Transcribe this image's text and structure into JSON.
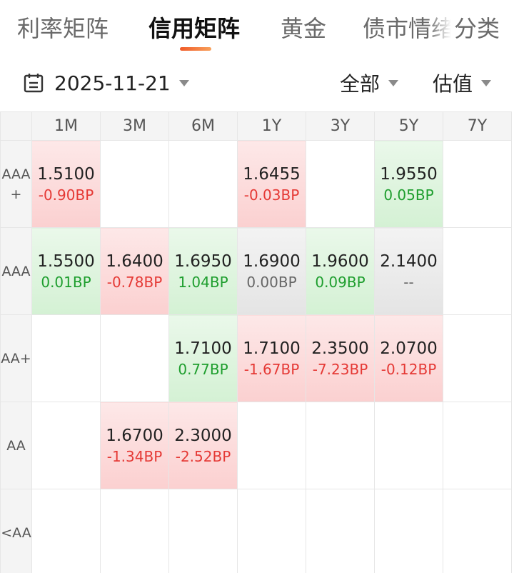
{
  "tabs": [
    {
      "label": "利率矩阵",
      "active": false
    },
    {
      "label": "信用矩阵",
      "active": true
    },
    {
      "label": "黄金",
      "active": false
    },
    {
      "label": "债市情绪",
      "active": false
    },
    {
      "label": "分类",
      "active": false
    }
  ],
  "filters": {
    "date": "2025-11-21",
    "scope": "全部",
    "metric": "估值"
  },
  "matrix": {
    "columns": [
      "1M",
      "3M",
      "6M",
      "1Y",
      "3Y",
      "5Y",
      "7Y"
    ],
    "rows": [
      {
        "rating": "AAA+",
        "cells": [
          {
            "value": "1.5100",
            "change": "-0.90BP",
            "trend": "up"
          },
          {
            "value": "",
            "change": "",
            "trend": "none"
          },
          {
            "value": "",
            "change": "",
            "trend": "none"
          },
          {
            "value": "1.6455",
            "change": "-0.03BP",
            "trend": "up"
          },
          {
            "value": "",
            "change": "",
            "trend": "none"
          },
          {
            "value": "1.9550",
            "change": "0.05BP",
            "trend": "down"
          },
          {
            "value": "",
            "change": "",
            "trend": "none"
          }
        ]
      },
      {
        "rating": "AAA",
        "cells": [
          {
            "value": "1.5500",
            "change": "0.01BP",
            "trend": "down"
          },
          {
            "value": "1.6400",
            "change": "-0.78BP",
            "trend": "up"
          },
          {
            "value": "1.6950",
            "change": "1.04BP",
            "trend": "down"
          },
          {
            "value": "1.6900",
            "change": "0.00BP",
            "trend": "flat"
          },
          {
            "value": "1.9600",
            "change": "0.09BP",
            "trend": "down"
          },
          {
            "value": "2.1400",
            "change": "--",
            "trend": "flat"
          },
          {
            "value": "",
            "change": "",
            "trend": "none"
          }
        ]
      },
      {
        "rating": "AA+",
        "cells": [
          {
            "value": "",
            "change": "",
            "trend": "none"
          },
          {
            "value": "",
            "change": "",
            "trend": "none"
          },
          {
            "value": "1.7100",
            "change": "0.77BP",
            "trend": "down"
          },
          {
            "value": "1.7100",
            "change": "-1.67BP",
            "trend": "up"
          },
          {
            "value": "2.3500",
            "change": "-7.23BP",
            "trend": "up"
          },
          {
            "value": "2.0700",
            "change": "-0.12BP",
            "trend": "up"
          },
          {
            "value": "",
            "change": "",
            "trend": "none"
          }
        ]
      },
      {
        "rating": "AA",
        "cells": [
          {
            "value": "",
            "change": "",
            "trend": "none"
          },
          {
            "value": "1.6700",
            "change": "-1.34BP",
            "trend": "up"
          },
          {
            "value": "2.3000",
            "change": "-2.52BP",
            "trend": "up"
          },
          {
            "value": "",
            "change": "",
            "trend": "none"
          },
          {
            "value": "",
            "change": "",
            "trend": "none"
          },
          {
            "value": "",
            "change": "",
            "trend": "none"
          },
          {
            "value": "",
            "change": "",
            "trend": "none"
          }
        ]
      },
      {
        "rating": "<AA",
        "cells": [
          {
            "value": "",
            "change": "",
            "trend": "none"
          },
          {
            "value": "",
            "change": "",
            "trend": "none"
          },
          {
            "value": "",
            "change": "",
            "trend": "none"
          },
          {
            "value": "",
            "change": "",
            "trend": "none"
          },
          {
            "value": "",
            "change": "",
            "trend": "none"
          },
          {
            "value": "",
            "change": "",
            "trend": "none"
          },
          {
            "value": "",
            "change": "",
            "trend": "none"
          }
        ]
      }
    ]
  },
  "colors": {
    "up_text": "#e53935",
    "down_text": "#1e9e2e",
    "accent": "#f05a28"
  },
  "icons": {
    "date": "calendar-icon",
    "dropdown": "caret-down-icon"
  }
}
